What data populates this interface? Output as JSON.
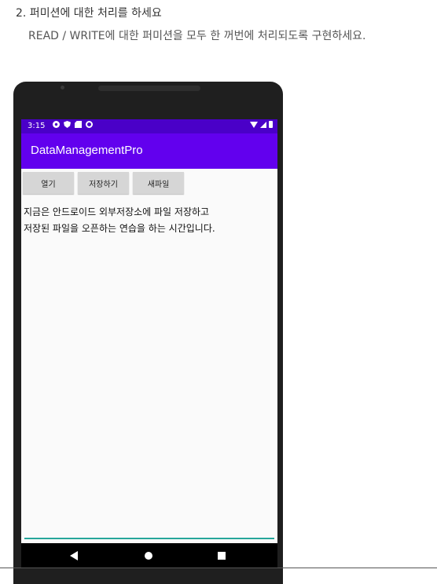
{
  "doc": {
    "title": "2. 퍼미션에 대한 처리를 하세요",
    "description": "READ / WRITE에 대한 퍼미션을 모두 한 꺼번에 처리되도록 구현하세요."
  },
  "status_bar": {
    "time": "3:15",
    "icons": [
      "gear-icon",
      "shield-icon",
      "sdcard-icon",
      "sync-icon"
    ],
    "right_icons": [
      "wifi-icon",
      "signal-icon",
      "battery-icon"
    ]
  },
  "app_bar": {
    "title": "DataManagementPro",
    "color": "#6200ee",
    "status_color": "#4a00c8"
  },
  "buttons": {
    "open": "열기",
    "save": "저장하기",
    "new_file": "새파일"
  },
  "content": {
    "text": "지금은 안드로이드 외부저장소에 파일 저장하고\n저장된 파일을 오픈하는 연습을 하는 시간입니다."
  },
  "nav_bar": {
    "icons": [
      "back-icon",
      "home-icon",
      "recents-icon"
    ]
  },
  "colors": {
    "underline": "#26a69a"
  }
}
